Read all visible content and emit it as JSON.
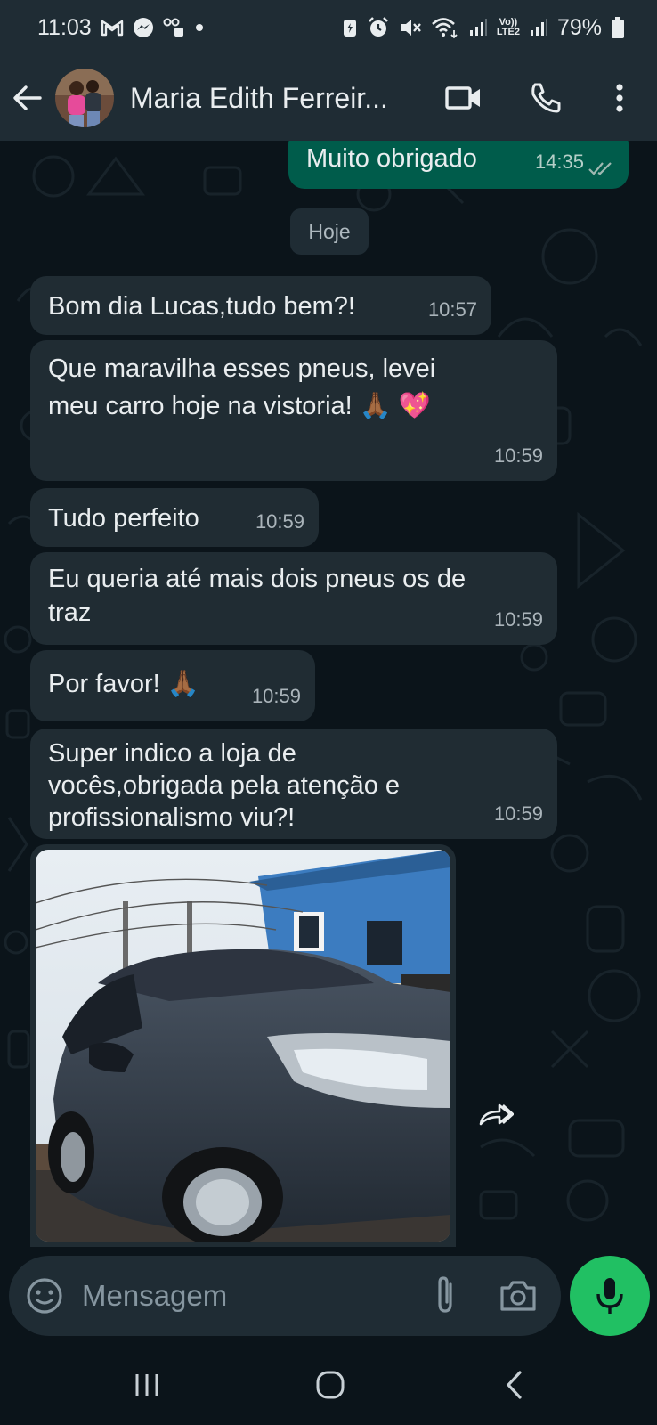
{
  "status_bar": {
    "time": "11:03",
    "network_lte": "LTE2",
    "network_vo": "Vo))",
    "battery": "79%"
  },
  "header": {
    "contact_name": "Maria Edith Ferreir..."
  },
  "chat": {
    "date_divider": "Hoje",
    "messages": [
      {
        "direction": "out",
        "text": "Muito obrigado",
        "time": "14:35",
        "status": "read"
      },
      {
        "direction": "in",
        "text": "Bom dia Lucas,tudo bem?!",
        "time": "10:57"
      },
      {
        "direction": "in",
        "line1": "Que maravilha esses pneus, levei",
        "line2": "meu carro hoje na vistoria! 🙏🏾 💖",
        "time": "10:59"
      },
      {
        "direction": "in",
        "text": "Tudo perfeito",
        "time": "10:59"
      },
      {
        "direction": "in",
        "line1": "Eu queria até mais dois pneus os de",
        "line2": "traz",
        "time": "10:59"
      },
      {
        "direction": "in",
        "text": "Por favor! 🙏🏾",
        "time": "10:59"
      },
      {
        "direction": "in",
        "line1": "Super indico a loja de",
        "line2": "vocês,obrigada pela atenção e",
        "line3": "profissionalismo viu?!",
        "time": "10:59"
      }
    ]
  },
  "composer": {
    "placeholder": "Mensagem"
  },
  "colors": {
    "background": "#0b141a",
    "bar": "#1f2c34",
    "incoming_bubble": "#202c33",
    "outgoing_bubble": "#005c4b",
    "accent_green": "#21c063"
  },
  "icons": [
    "back-arrow-icon",
    "video-call-icon",
    "phone-icon",
    "more-options-icon",
    "emoji-icon",
    "attach-icon",
    "camera-icon",
    "mic-icon",
    "forward-icon",
    "read-receipt-icon"
  ]
}
